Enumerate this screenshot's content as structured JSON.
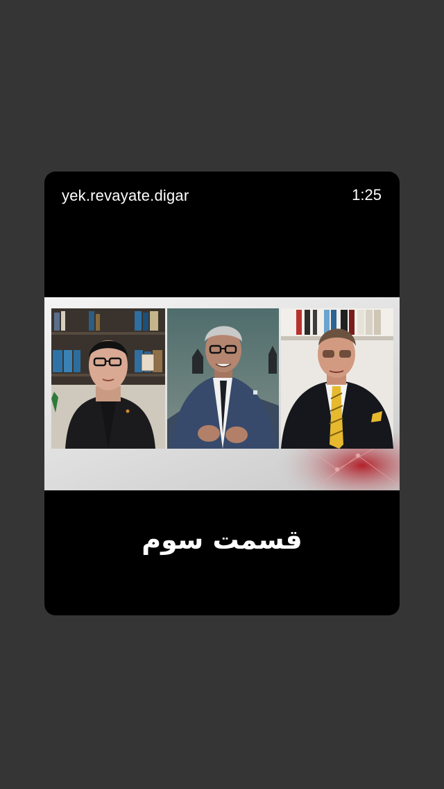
{
  "story": {
    "account_name": "yek.revayate.digar",
    "duration": "1:25",
    "caption": "قسمت سوم"
  },
  "video": {
    "panels": [
      {
        "id": "left",
        "subject": "man-with-glasses-bookshelf"
      },
      {
        "id": "center",
        "subject": "man-gesturing-teal-background"
      },
      {
        "id": "right",
        "subject": "man-yellow-tie-bookshelf"
      }
    ]
  },
  "colors": {
    "background": "#353535",
    "card": "#000000",
    "text": "#ffffff"
  }
}
